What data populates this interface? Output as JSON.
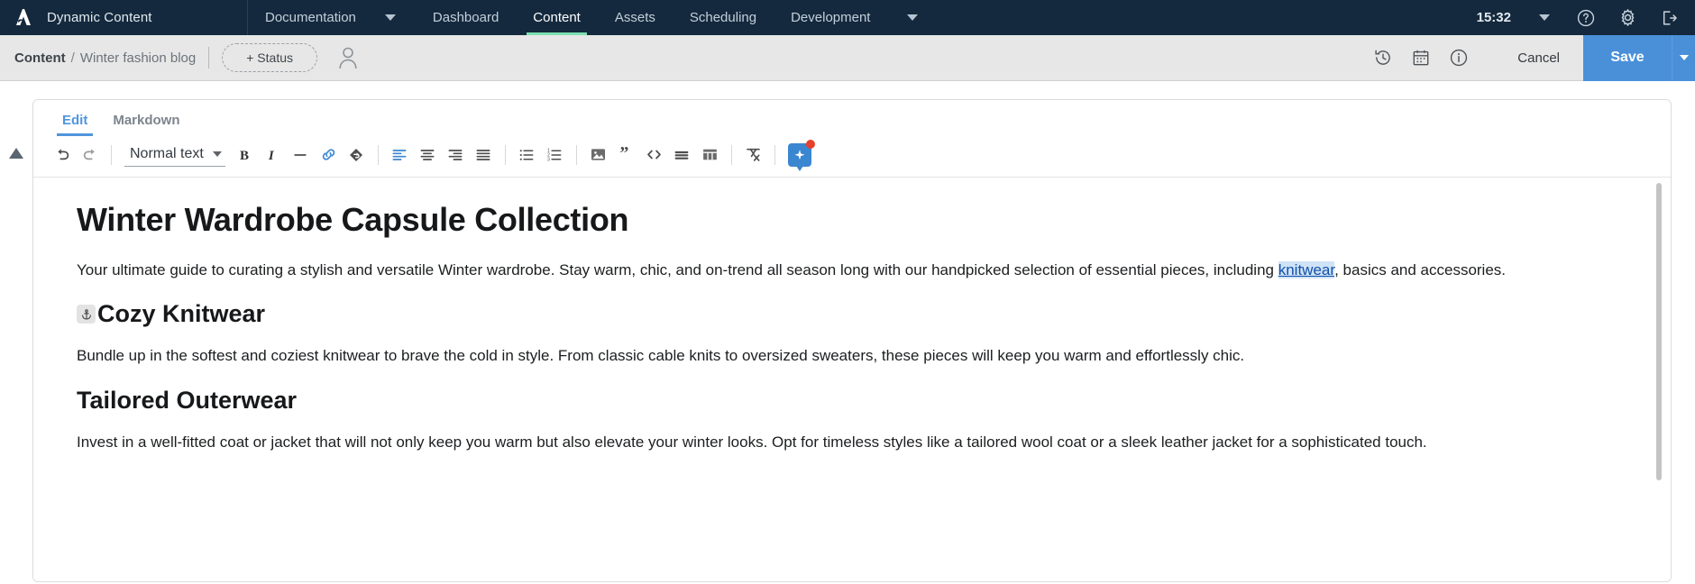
{
  "topnav": {
    "brand": "Dynamic Content",
    "logo_icon": "amplience-logo-icon",
    "items": [
      {
        "label": "Documentation",
        "icon": "",
        "active": false,
        "caret": true
      },
      {
        "label": "Dashboard",
        "active": false,
        "caret": false
      },
      {
        "label": "Content",
        "active": true,
        "caret": false
      },
      {
        "label": "Assets",
        "active": false,
        "caret": false
      },
      {
        "label": "Scheduling",
        "active": false,
        "caret": false
      },
      {
        "label": "Development",
        "active": false,
        "caret": true
      }
    ],
    "clock": "15:32",
    "right_icons": [
      "chevron-down-icon",
      "help-icon",
      "gear-icon",
      "logout-icon"
    ],
    "active_underline_color": "#7ce0b1",
    "background_color": "#14293d"
  },
  "subheader": {
    "breadcrumb_root": "Content",
    "breadcrumb_sep": "/",
    "breadcrumb_doc": "Winter fashion blog",
    "status_button": "+ Status",
    "avatar_icon": "user-avatar-icon",
    "right_icons": [
      "history-icon",
      "calendar-icon",
      "info-icon"
    ],
    "cancel_label": "Cancel",
    "save_label": "Save",
    "save_color": "#4a90d9",
    "background_color": "#e7e7e7"
  },
  "editor": {
    "tabs": [
      {
        "label": "Edit",
        "active": true
      },
      {
        "label": "Markdown",
        "active": false
      }
    ],
    "active_tab_color": "#5095dd",
    "toolbar": {
      "undo": "undo-icon",
      "redo": "redo-icon",
      "style_value": "Normal text",
      "bold": "bold-icon",
      "italic": "italic-icon",
      "strikethrough": "strikethrough-icon",
      "link": "link-icon",
      "anchor": "anchor-marker-icon",
      "align_left": "align-left-icon",
      "align_center": "align-center-icon",
      "align_right": "align-right-icon",
      "align_justify": "align-justify-icon",
      "bullet_list": "bullet-list-icon",
      "numbered_list": "numbered-list-icon",
      "image": "image-icon",
      "quote": "blockquote-icon",
      "code": "code-icon",
      "horizontal_rule": "horizontal-rule-icon",
      "table": "table-icon",
      "clear_format": "clear-formatting-icon",
      "ai_assist": "ai-sparkle-icon",
      "link_active_color": "#4a90d9",
      "align_active_color": "#4a90d9",
      "ai_badge_color": "#e8402a"
    },
    "document": {
      "title": "Winter Wardrobe Capsule Collection",
      "intro_before": "Your ultimate guide to curating a stylish and versatile Winter wardrobe. Stay warm, chic, and on-trend all season long with our handpicked selection of essential pieces, including ",
      "intro_link": "knitwear",
      "intro_after": ", basics and accessories.",
      "heading_1": "Cozy Knitwear",
      "heading_1_anchor": "anchor-icon",
      "para_1": "Bundle up in the softest and coziest knitwear to brave the cold in style. From classic cable knits to oversized sweaters, these pieces will keep you warm and effortlessly chic.",
      "heading_2": "Tailored Outerwear",
      "para_2": "Invest in a well-fitted coat or jacket that will not only keep you warm but also elevate your winter looks. Opt for timeless styles like a tailored wool coat or a sleek leather jacket for a sophisticated touch."
    }
  }
}
